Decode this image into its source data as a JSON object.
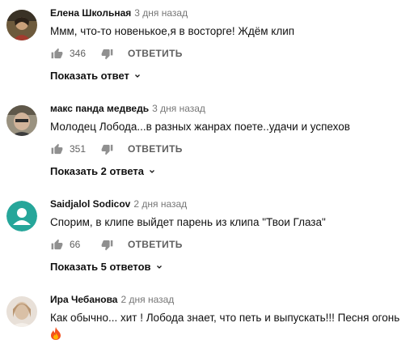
{
  "comments": [
    {
      "author": "Елена Школьная",
      "time": "3 дня назад",
      "text": "Ммм, что-то новенькое,я в восторге! Ждём клип",
      "likes": "346",
      "reply_label": "ОТВЕТИТЬ",
      "replies_label": "Показать ответ",
      "avatar_icon": "photo-avatar"
    },
    {
      "author": "макс панда медведь",
      "time": "3 дня назад",
      "text": "Молодец Лобода...в разных жанрах поете..удачи и успехов",
      "likes": "351",
      "reply_label": "ОТВЕТИТЬ",
      "replies_label": "Показать 2 ответа",
      "avatar_icon": "photo-avatar"
    },
    {
      "author": "Saidjalol Sodicov",
      "time": "2 дня назад",
      "text": "Спорим, в клипе выйдет парень из клипа \"Твои Глаза\"",
      "likes": "66",
      "reply_label": "ОТВЕТИТЬ",
      "replies_label": "Показать 5 ответов",
      "avatar_icon": "default-user-avatar",
      "avatar_color": "#26a69a"
    },
    {
      "author": "Ира Чебанова",
      "time": "2 дня назад",
      "text": "Как обычно... хит ! Лобода знает, что петь и выпускать!!! Песня огонь",
      "emoji": "fire-emoji",
      "avatar_icon": "photo-avatar"
    }
  ]
}
